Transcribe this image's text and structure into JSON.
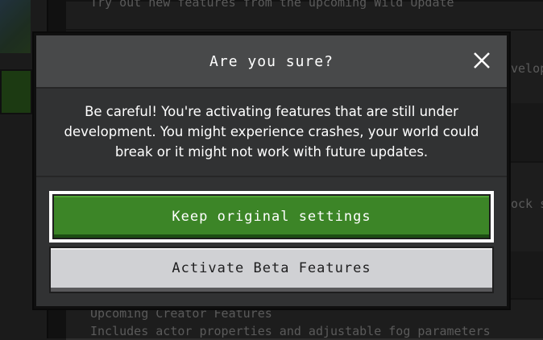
{
  "background": {
    "top_text": "Try out new features from the upcoming Wild Update",
    "row_right_fragment_1": "velop",
    "row_right_fragment_2": "ock s",
    "bottom_heading": "Upcoming Creator Features",
    "bottom_desc": "Includes actor properties and adjustable fog parameters"
  },
  "dialog": {
    "title": "Are you sure?",
    "message": "Be careful! You're activating features that are still under development. You might experience crashes, your world could break or it might not work with future updates.",
    "primary_button": "Keep original settings",
    "secondary_button": "Activate Beta Features",
    "close_icon": "close-icon"
  },
  "colors": {
    "primary": "#3c8527",
    "secondary": "#d0d1d4",
    "dialog_bg": "#313233",
    "titlebar_bg": "#48494a"
  }
}
